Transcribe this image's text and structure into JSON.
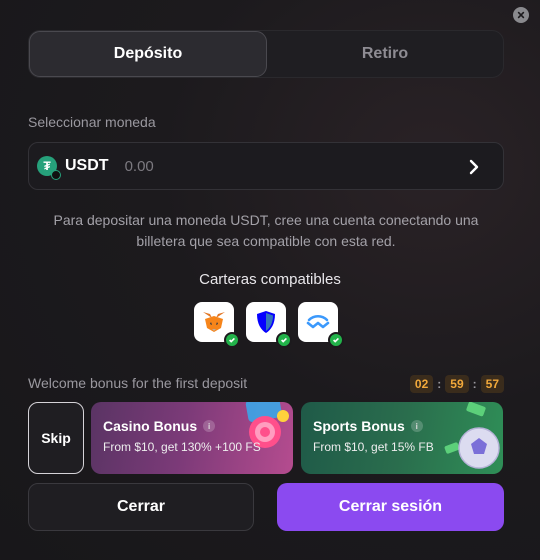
{
  "tabs": [
    {
      "label": "Depósito",
      "active": true
    },
    {
      "label": "Retiro",
      "active": false
    }
  ],
  "currency": {
    "section_label": "Seleccionar moneda",
    "symbol": "USDT",
    "amount": "0.00",
    "icon": "tether-icon"
  },
  "info_text": "Para depositar una moneda USDT, cree una cuenta conectando una billetera que sea compatible con esta red.",
  "wallets": {
    "title": "Carteras compatibles",
    "items": [
      {
        "name": "metamask-icon"
      },
      {
        "name": "trustwallet-icon"
      },
      {
        "name": "walletconnect-icon"
      }
    ]
  },
  "bonus": {
    "label": "Welcome bonus for the first deposit",
    "timer": {
      "hours": "02",
      "minutes": "59",
      "seconds": "57"
    },
    "skip_label": "Skip",
    "cards": [
      {
        "title": "Casino Bonus",
        "desc": "From $10, get 130% +100 FS",
        "info": "i"
      },
      {
        "title": "Sports Bonus",
        "desc": "From $10, get 15% FB",
        "info": "i"
      }
    ]
  },
  "actions": {
    "close_label": "Cerrar",
    "logout_label": "Cerrar sesión"
  },
  "colors": {
    "accent": "#8b4af0",
    "timer": "#f2a93b",
    "check": "#22b34a",
    "tether": "#26a17b"
  }
}
